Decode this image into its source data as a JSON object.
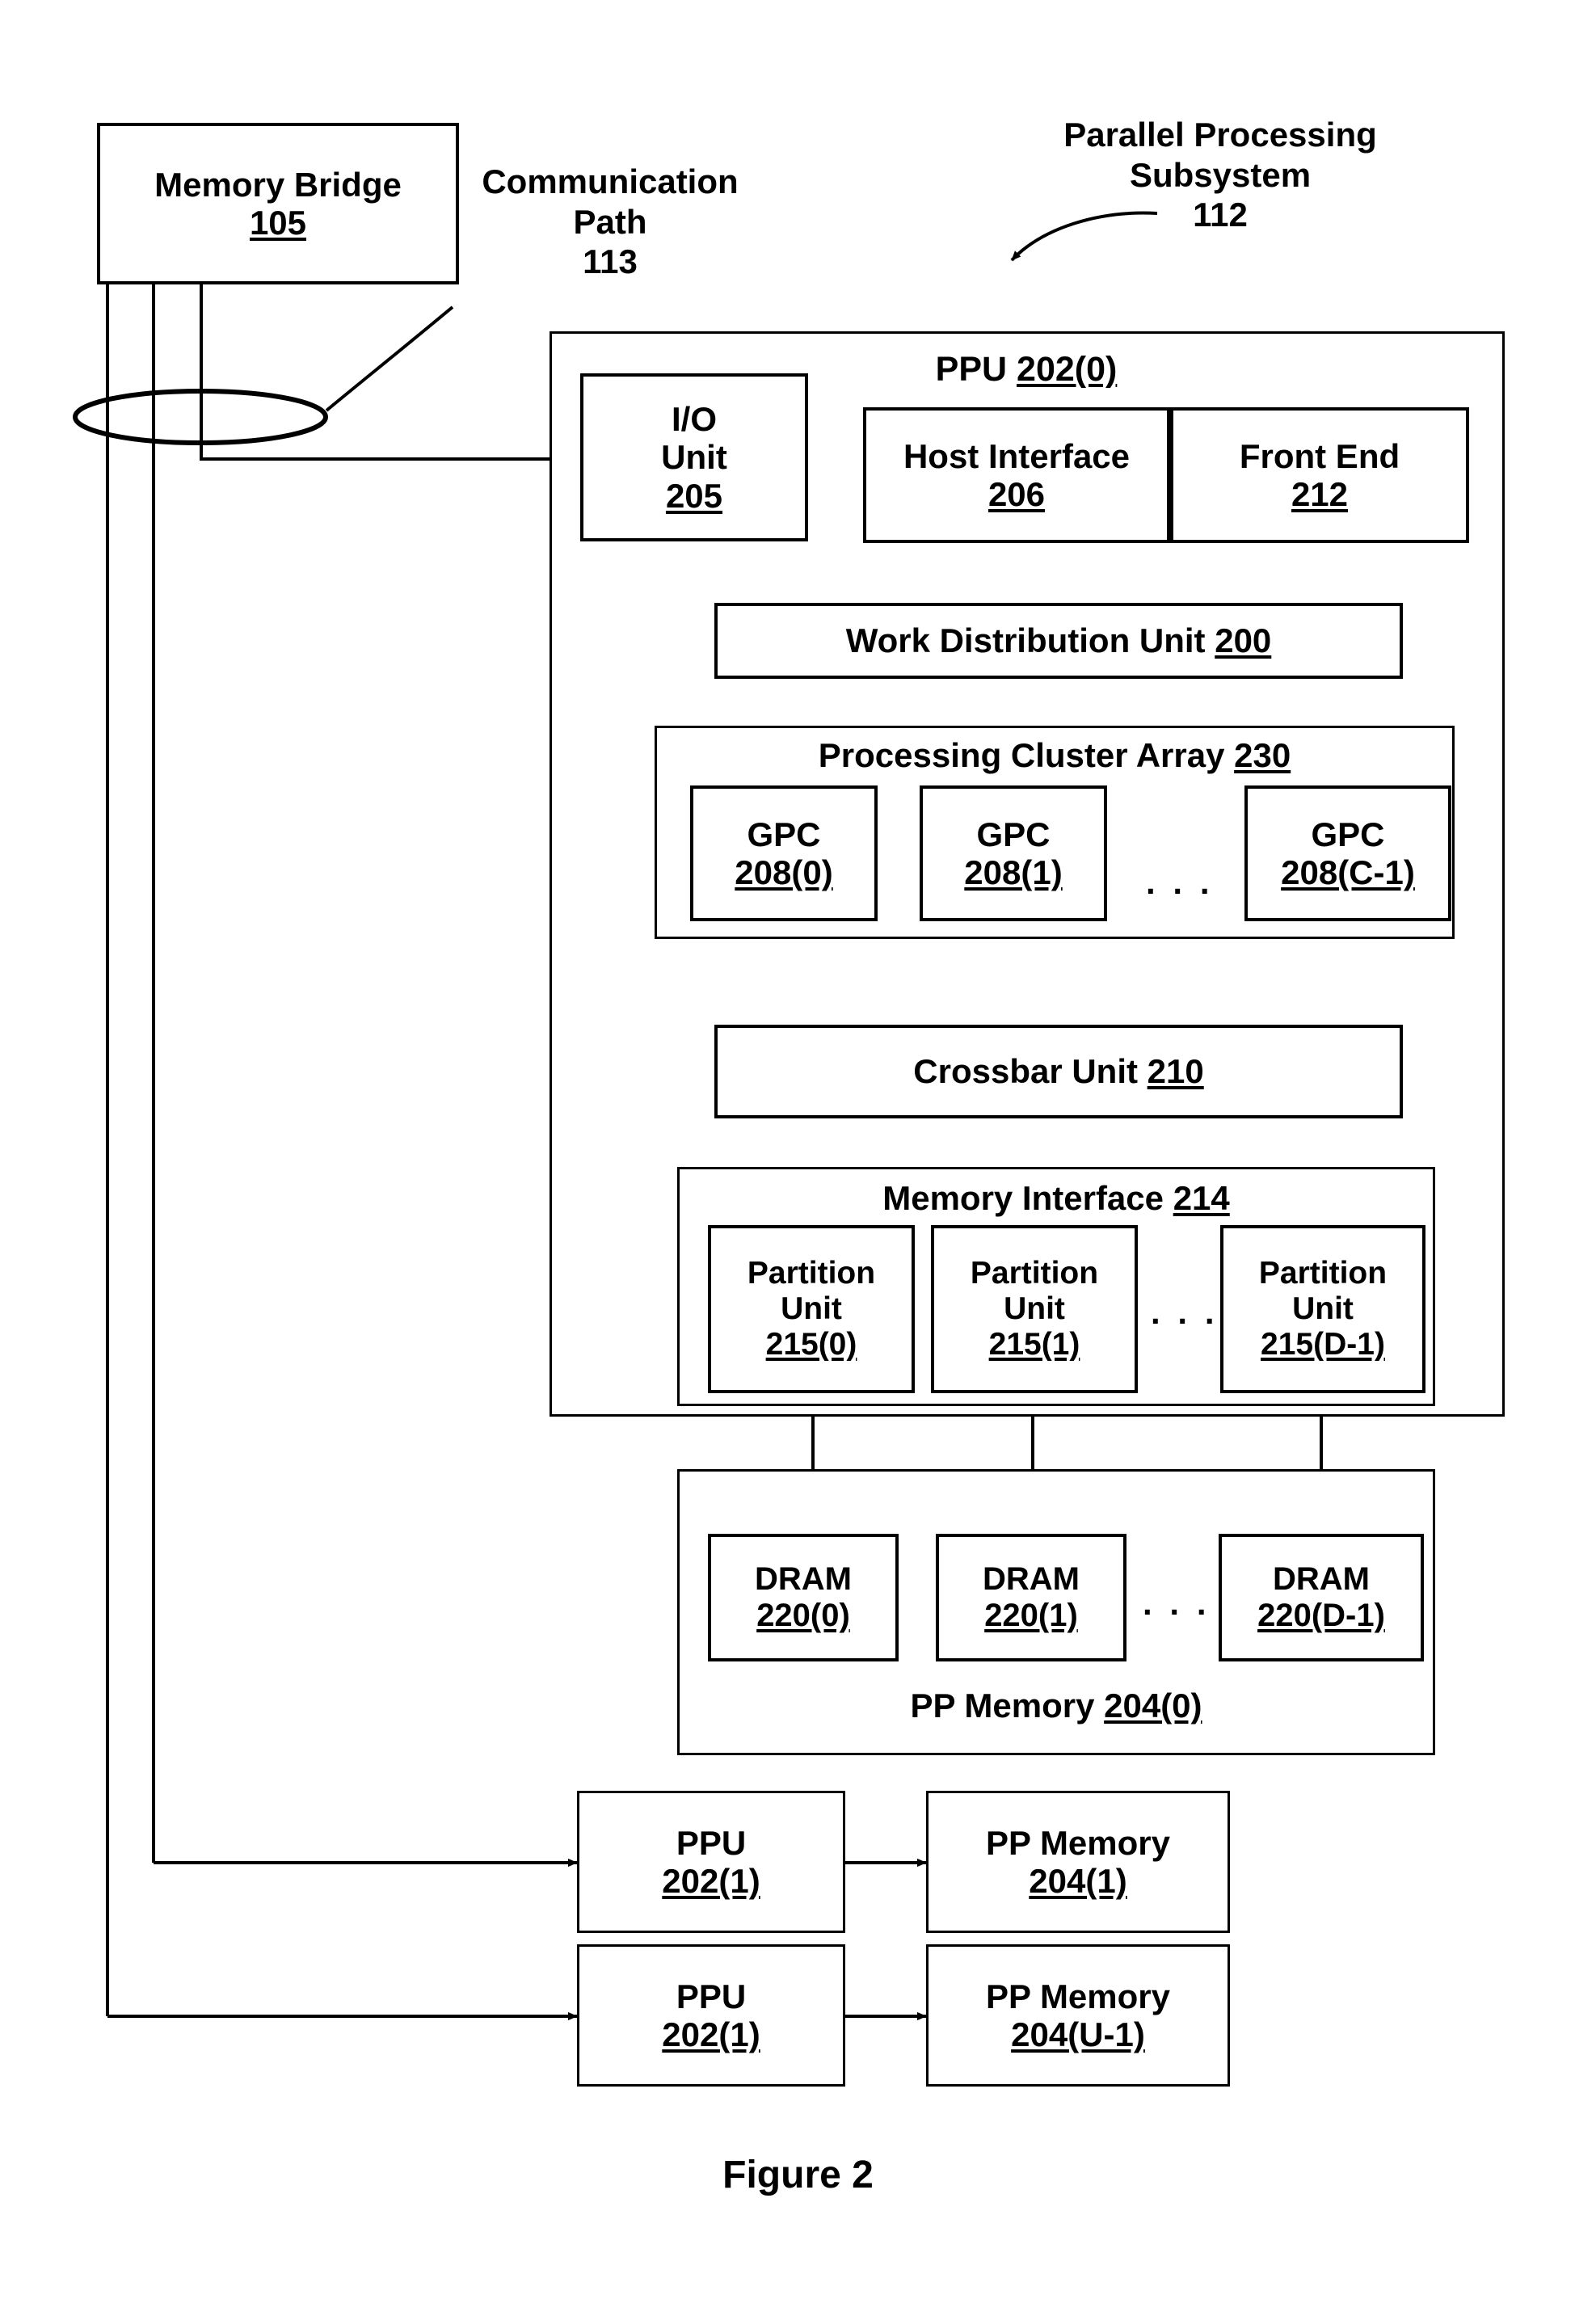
{
  "figure": {
    "caption": "Figure 2"
  },
  "labels": {
    "communication_path": {
      "line1": "Communication",
      "line2": "Path",
      "ref": "113"
    },
    "pp_subsystem": {
      "line1": "Parallel Processing",
      "line2": "Subsystem",
      "ref": "112"
    }
  },
  "memory_bridge": {
    "name": "Memory Bridge",
    "ref": "105"
  },
  "ppu0": {
    "title_prefix": "PPU ",
    "title_ref": "202(0)",
    "io_unit": {
      "line1": "I/O",
      "line2": "Unit",
      "ref": "205"
    },
    "host_interface": {
      "name": "Host Interface",
      "ref": "206"
    },
    "front_end": {
      "name": "Front End",
      "ref": "212"
    },
    "work_distribution_unit": {
      "name": "Work Distribution Unit ",
      "ref": "200"
    },
    "processing_cluster_array": {
      "title": "Processing Cluster Array ",
      "title_ref": "230",
      "ellipsis": ". . .",
      "gpcs": [
        {
          "name": "GPC",
          "ref": "208(0)"
        },
        {
          "name": "GPC",
          "ref": "208(1)"
        },
        {
          "name": "GPC",
          "ref": "208(C-1)"
        }
      ]
    },
    "crossbar_unit": {
      "name": "Crossbar Unit ",
      "ref": "210"
    },
    "memory_interface": {
      "title": "Memory Interface ",
      "title_ref": "214",
      "ellipsis": ". . .",
      "partitions": [
        {
          "line1": "Partition",
          "line2": "Unit",
          "ref": "215(0)"
        },
        {
          "line1": "Partition",
          "line2": "Unit",
          "ref": "215(1)"
        },
        {
          "line1": "Partition",
          "line2": "Unit",
          "ref": "215(D-1)"
        }
      ]
    }
  },
  "pp_memory0": {
    "title": "PP Memory ",
    "title_ref": "204(0)",
    "ellipsis": ". . .",
    "drams": [
      {
        "name": "DRAM",
        "ref": "220(0)"
      },
      {
        "name": "DRAM",
        "ref": "220(1)"
      },
      {
        "name": "DRAM",
        "ref": "220(D-1)"
      }
    ]
  },
  "extra_rows": [
    {
      "ppu": {
        "name": "PPU",
        "ref": "202(1)"
      },
      "memory": {
        "name": "PP Memory",
        "ref": "204(1)"
      }
    },
    {
      "ppu": {
        "name": "PPU",
        "ref": "202(1)"
      },
      "memory": {
        "name": "PP Memory",
        "ref": "204(U-1)"
      }
    }
  ],
  "vertical_ellipsis": ".\n.\n.",
  "colors": {
    "ink": "#000000",
    "paper": "#ffffff"
  }
}
